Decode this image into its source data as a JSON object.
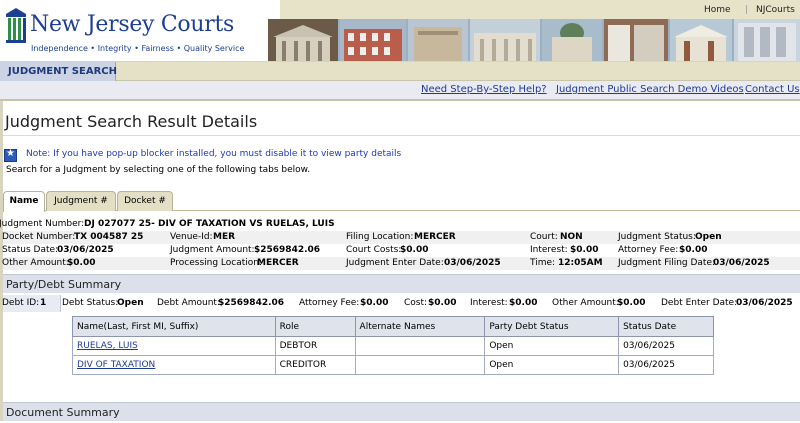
{
  "header": {
    "logo_title": "New Jersey Courts",
    "logo_subtitle": "Independence • Integrity • Fairness • Quality Service",
    "top_links": [
      "Home",
      "NJCourts"
    ]
  },
  "nav": {
    "active_tab": "JUDGMENT SEARCH"
  },
  "links": [
    {
      "label": "Need Step-By-Step Help?"
    },
    {
      "label": "Judgment Public Search Demo Videos"
    },
    {
      "label": "Contact Us"
    }
  ],
  "page": {
    "title": "Judgment Search Result Details",
    "note": "Note: If you have pop-up blocker installed, you must disable it to view party details",
    "instruction": "Search for a Judgment by selecting one of the following tabs below."
  },
  "search_tabs": [
    "Name",
    "Judgment #",
    "Docket #"
  ],
  "judgment": {
    "number_label": "Judgment Number:",
    "number_value": "DJ 027077 25- DIV OF TAXATION VS RUELAS, LUIS",
    "rows": [
      [
        {
          "label": "Docket Number:",
          "value": "TX 004587 25"
        },
        {
          "label": "Venue-Id:",
          "value": "MER"
        },
        {
          "label": "Filing Location:",
          "value": "MERCER"
        },
        {
          "label": "Court:",
          "value": "NON"
        },
        {
          "label": "Judgment Status:",
          "value": "Open"
        }
      ],
      [
        {
          "label": "Status Date:",
          "value": "03/06/2025"
        },
        {
          "label": "Judgment Amount:",
          "value": "$2569842.06"
        },
        {
          "label": "Court Costs:",
          "value": "$0.00"
        },
        {
          "label": "Interest:",
          "value": "$0.00"
        },
        {
          "label": "Attorney Fee:",
          "value": "$0.00"
        }
      ],
      [
        {
          "label": "Other Amount:",
          "value": "$0.00"
        },
        {
          "label": "Processing Location:",
          "value": "MERCER"
        },
        {
          "label": "Judgment Enter Date:",
          "value": "03/06/2025"
        },
        {
          "label": "Time:",
          "value": "12:05AM"
        },
        {
          "label": "Judgment Filing Date:",
          "value": "03/06/2025"
        }
      ]
    ]
  },
  "party_debt": {
    "section_title": "Party/Debt Summary",
    "debt_id": {
      "label": "Debt ID:",
      "value": "1"
    },
    "fields": [
      {
        "label": "Debt Status:",
        "value": "Open"
      },
      {
        "label": "Debt Amount:",
        "value": "$2569842.06"
      },
      {
        "label": "Attorney Fee:",
        "value": "$0.00"
      },
      {
        "label": "Cost:",
        "value": "$0.00"
      },
      {
        "label": "Interest:",
        "value": "$0.00"
      },
      {
        "label": "Other Amount:",
        "value": "$0.00"
      },
      {
        "label": "Debt Enter Date:",
        "value": "03/06/2025"
      }
    ],
    "table_headers": [
      "Name(Last, First MI, Suffix)",
      "Role",
      "Alternate Names",
      "Party Debt Status",
      "Status Date"
    ],
    "parties": [
      {
        "name": "RUELAS, LUIS",
        "role": "DEBTOR",
        "alternate": "",
        "status": "Open",
        "date": "03/06/2025"
      },
      {
        "name": "DIV OF TAXATION",
        "role": "CREDITOR",
        "alternate": "",
        "status": "Open",
        "date": "03/06/2025"
      }
    ]
  },
  "document_summary": {
    "section_title": "Document Summary"
  }
}
